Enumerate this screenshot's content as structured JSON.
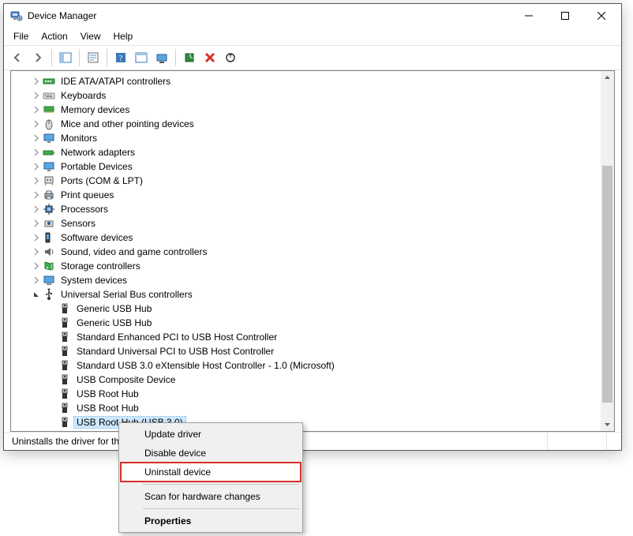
{
  "window": {
    "title": "Device Manager"
  },
  "menubar": {
    "items": [
      "File",
      "Action",
      "View",
      "Help"
    ]
  },
  "tree": {
    "categories": [
      {
        "label": "IDE ATA/ATAPI controllers",
        "icon": "ide-icon",
        "expanded": false
      },
      {
        "label": "Keyboards",
        "icon": "keyboard-icon",
        "expanded": false
      },
      {
        "label": "Memory devices",
        "icon": "memory-icon",
        "expanded": false
      },
      {
        "label": "Mice and other pointing devices",
        "icon": "mouse-icon",
        "expanded": false
      },
      {
        "label": "Monitors",
        "icon": "monitor-icon",
        "expanded": false
      },
      {
        "label": "Network adapters",
        "icon": "network-icon",
        "expanded": false
      },
      {
        "label": "Portable Devices",
        "icon": "portable-icon",
        "expanded": false
      },
      {
        "label": "Ports (COM & LPT)",
        "icon": "port-icon",
        "expanded": false
      },
      {
        "label": "Print queues",
        "icon": "printer-icon",
        "expanded": false
      },
      {
        "label": "Processors",
        "icon": "cpu-icon",
        "expanded": false
      },
      {
        "label": "Sensors",
        "icon": "sensor-icon",
        "expanded": false
      },
      {
        "label": "Software devices",
        "icon": "software-icon",
        "expanded": false
      },
      {
        "label": "Sound, video and game controllers",
        "icon": "sound-icon",
        "expanded": false
      },
      {
        "label": "Storage controllers",
        "icon": "storage-icon",
        "expanded": false
      },
      {
        "label": "System devices",
        "icon": "system-icon",
        "expanded": false
      },
      {
        "label": "Universal Serial Bus controllers",
        "icon": "usb-icon",
        "expanded": true,
        "children": [
          {
            "label": "Generic USB Hub"
          },
          {
            "label": "Generic USB Hub"
          },
          {
            "label": "Standard Enhanced PCI to USB Host Controller"
          },
          {
            "label": "Standard Universal PCI to USB Host Controller"
          },
          {
            "label": "Standard USB 3.0 eXtensible Host Controller - 1.0 (Microsoft)"
          },
          {
            "label": "USB Composite Device"
          },
          {
            "label": "USB Root Hub"
          },
          {
            "label": "USB Root Hub"
          },
          {
            "label": "USB Root Hub (USB 3.0)",
            "selected": true
          }
        ]
      }
    ]
  },
  "context_menu": {
    "items": [
      {
        "label": "Update driver"
      },
      {
        "label": "Disable device"
      },
      {
        "label": "Uninstall device",
        "highlight": true
      },
      {
        "sep": true
      },
      {
        "label": "Scan for hardware changes"
      },
      {
        "sep": true
      },
      {
        "label": "Properties",
        "bold": true
      }
    ]
  },
  "statusbar": {
    "text": "Uninstalls the driver for the selected device."
  }
}
